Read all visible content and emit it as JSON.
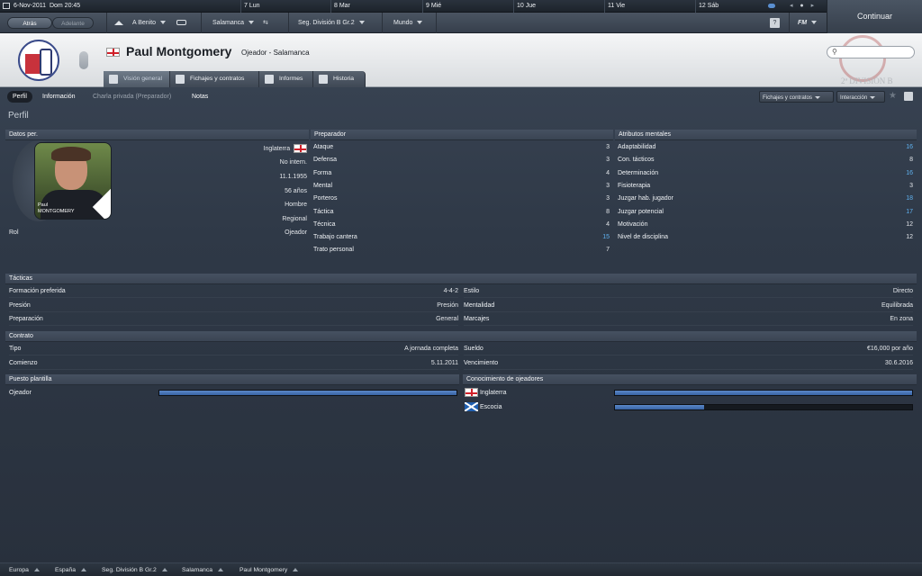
{
  "datebar": {
    "date": "6-Nov-2011",
    "time": "Dom  20:45",
    "days": [
      "7  Lun",
      "8  Mar",
      "9  Mié",
      "10  Jue",
      "11  Vie",
      "12  Sáb"
    ]
  },
  "continue_label": "Continuar",
  "nav": {
    "back": "Atrás",
    "forward": "Adelante",
    "manager": "A Benito",
    "club": "Salamanca",
    "competition": "Seg. División B Gr.2",
    "world": "Mundo",
    "help": "?",
    "fm": "FM"
  },
  "header": {
    "name": "Paul Montgomery",
    "role": "Ojeador - Salamanca",
    "watermark": "2ª DIVISIÓN B",
    "search_placeholder": ""
  },
  "tabs": [
    "Visión general",
    "Fichajes y contratos",
    "Informes",
    "Historia"
  ],
  "subnav": {
    "items": [
      "Perfil",
      "Información",
      "Charla privada (Preparador)",
      "Notas"
    ],
    "right_buttons": [
      "Fichajes y contratos",
      "Interacción"
    ]
  },
  "page_title": "Perfil",
  "personal": {
    "heading": "Datos per.",
    "nationality": "Inglaterra",
    "caps": "No intern.",
    "dob": "11.1.1955",
    "age": "56 años",
    "gender": "Hombre",
    "ethnicity": "Regional",
    "role_label": "Rol",
    "role_value": "Ojeador",
    "photo_caption_first": "Paul",
    "photo_caption_last": "MONTGOMERY"
  },
  "coach": {
    "heading": "Preparador",
    "rows": [
      {
        "label": "Ataque",
        "value": "3"
      },
      {
        "label": "Defensa",
        "value": "3"
      },
      {
        "label": "Forma",
        "value": "4"
      },
      {
        "label": "Mental",
        "value": "3"
      },
      {
        "label": "Porteros",
        "value": "3"
      },
      {
        "label": "Táctica",
        "value": "8"
      },
      {
        "label": "Técnica",
        "value": "4"
      },
      {
        "label": "Trabajo cantera",
        "value": "15"
      },
      {
        "label": "Trato personal",
        "value": "7"
      }
    ]
  },
  "mental": {
    "heading": "Atributos mentales",
    "rows": [
      {
        "label": "Adaptabilidad",
        "value": "16"
      },
      {
        "label": "Con. tácticos",
        "value": "8"
      },
      {
        "label": "Determinación",
        "value": "16"
      },
      {
        "label": "Fisioterapia",
        "value": "3"
      },
      {
        "label": "Juzgar hab. jugador",
        "value": "18"
      },
      {
        "label": "Juzgar potencial",
        "value": "17"
      },
      {
        "label": "Motivación",
        "value": "12"
      },
      {
        "label": "Nivel de disciplina",
        "value": "12"
      }
    ]
  },
  "tactics": {
    "heading": "Tácticas",
    "left": [
      {
        "label": "Formación preferida",
        "value": "4-4-2"
      },
      {
        "label": "Presión",
        "value": "Presión"
      },
      {
        "label": "Preparación",
        "value": "General"
      }
    ],
    "right": [
      {
        "label": "Estilo",
        "value": "Directo"
      },
      {
        "label": "Mentalidad",
        "value": "Equilibrada"
      },
      {
        "label": "Marcajes",
        "value": "En zona"
      }
    ]
  },
  "contract": {
    "heading": "Contrato",
    "left": [
      {
        "label": "Tipo",
        "value": "A jornada completa"
      },
      {
        "label": "Comienzo",
        "value": "5.11.2011"
      }
    ],
    "right": [
      {
        "label": "Sueldo",
        "value": "€16,000 por año"
      },
      {
        "label": "Vencimiento",
        "value": "30.6.2016"
      }
    ]
  },
  "squad": {
    "heading": "Puesto plantilla",
    "label": "Ojeador",
    "level": 1.0
  },
  "knowledge": {
    "heading": "Conocimiento de ojeadores",
    "rows": [
      {
        "label": "Inglaterra",
        "level": 1.0
      },
      {
        "label": "Escocia",
        "level": 0.3
      }
    ]
  },
  "footer": [
    "Europa",
    "España",
    "Seg. División B Gr.2",
    "Salamanca",
    "Paul Montgomery"
  ],
  "colors": {
    "accent_blue": "#5fb2f0",
    "bar_fill": "#4a78bb"
  }
}
